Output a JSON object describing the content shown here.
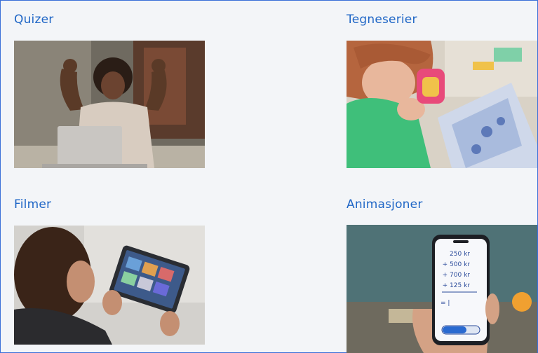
{
  "cards": [
    {
      "title": "Quizer",
      "image": "woman-celebrating-at-laptop-photo"
    },
    {
      "title": "Tegneserier",
      "image": "child-reading-comic-photo"
    },
    {
      "title": "Filmer",
      "image": "person-watching-tablet-photo"
    },
    {
      "title": "Animasjoner",
      "image": "phone-calculator-animation-photo",
      "phone_lines": [
        "250 kr",
        "+ 500 kr",
        "+ 700 kr",
        "+ 125 kr",
        "= |"
      ]
    }
  ],
  "colors": {
    "title": "#1f66c6",
    "frame_border": "#3a6fd8",
    "background": "#f3f5f8"
  }
}
